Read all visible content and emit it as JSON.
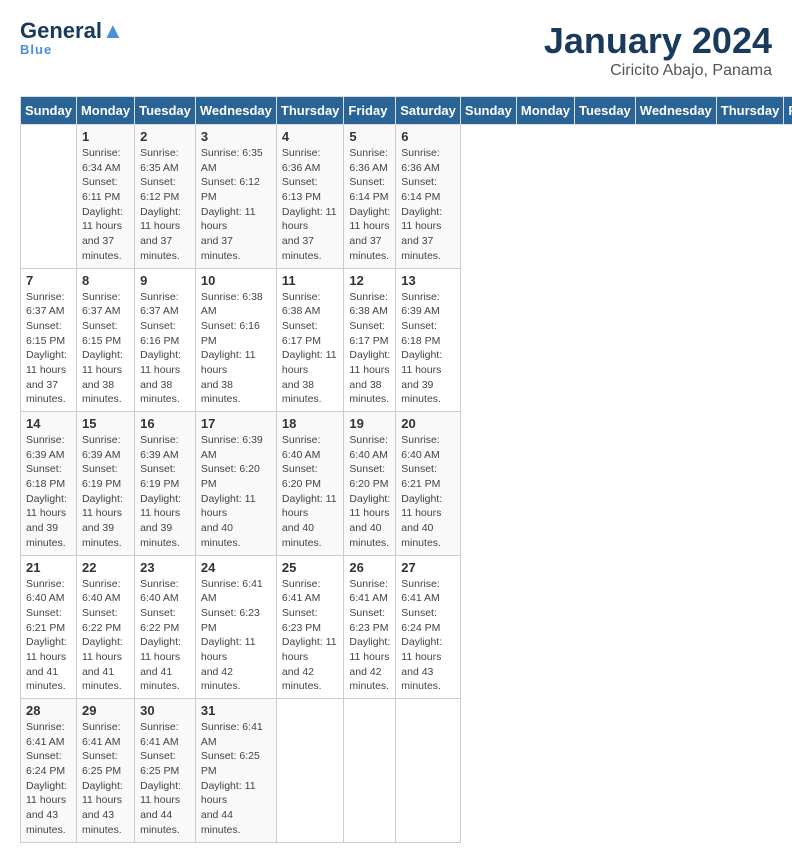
{
  "logo": {
    "line1": "General",
    "line2": "Blue",
    "tagline": "Blue"
  },
  "title": "January 2024",
  "location": "Ciricito Abajo, Panama",
  "days_of_week": [
    "Sunday",
    "Monday",
    "Tuesday",
    "Wednesday",
    "Thursday",
    "Friday",
    "Saturday"
  ],
  "weeks": [
    [
      {
        "day": "",
        "info": ""
      },
      {
        "day": "1",
        "info": "Sunrise: 6:34 AM\nSunset: 6:11 PM\nDaylight: 11 hours\nand 37 minutes."
      },
      {
        "day": "2",
        "info": "Sunrise: 6:35 AM\nSunset: 6:12 PM\nDaylight: 11 hours\nand 37 minutes."
      },
      {
        "day": "3",
        "info": "Sunrise: 6:35 AM\nSunset: 6:12 PM\nDaylight: 11 hours\nand 37 minutes."
      },
      {
        "day": "4",
        "info": "Sunrise: 6:36 AM\nSunset: 6:13 PM\nDaylight: 11 hours\nand 37 minutes."
      },
      {
        "day": "5",
        "info": "Sunrise: 6:36 AM\nSunset: 6:14 PM\nDaylight: 11 hours\nand 37 minutes."
      },
      {
        "day": "6",
        "info": "Sunrise: 6:36 AM\nSunset: 6:14 PM\nDaylight: 11 hours\nand 37 minutes."
      }
    ],
    [
      {
        "day": "7",
        "info": "Sunrise: 6:37 AM\nSunset: 6:15 PM\nDaylight: 11 hours\nand 37 minutes."
      },
      {
        "day": "8",
        "info": "Sunrise: 6:37 AM\nSunset: 6:15 PM\nDaylight: 11 hours\nand 38 minutes."
      },
      {
        "day": "9",
        "info": "Sunrise: 6:37 AM\nSunset: 6:16 PM\nDaylight: 11 hours\nand 38 minutes."
      },
      {
        "day": "10",
        "info": "Sunrise: 6:38 AM\nSunset: 6:16 PM\nDaylight: 11 hours\nand 38 minutes."
      },
      {
        "day": "11",
        "info": "Sunrise: 6:38 AM\nSunset: 6:17 PM\nDaylight: 11 hours\nand 38 minutes."
      },
      {
        "day": "12",
        "info": "Sunrise: 6:38 AM\nSunset: 6:17 PM\nDaylight: 11 hours\nand 38 minutes."
      },
      {
        "day": "13",
        "info": "Sunrise: 6:39 AM\nSunset: 6:18 PM\nDaylight: 11 hours\nand 39 minutes."
      }
    ],
    [
      {
        "day": "14",
        "info": "Sunrise: 6:39 AM\nSunset: 6:18 PM\nDaylight: 11 hours\nand 39 minutes."
      },
      {
        "day": "15",
        "info": "Sunrise: 6:39 AM\nSunset: 6:19 PM\nDaylight: 11 hours\nand 39 minutes."
      },
      {
        "day": "16",
        "info": "Sunrise: 6:39 AM\nSunset: 6:19 PM\nDaylight: 11 hours\nand 39 minutes."
      },
      {
        "day": "17",
        "info": "Sunrise: 6:39 AM\nSunset: 6:20 PM\nDaylight: 11 hours\nand 40 minutes."
      },
      {
        "day": "18",
        "info": "Sunrise: 6:40 AM\nSunset: 6:20 PM\nDaylight: 11 hours\nand 40 minutes."
      },
      {
        "day": "19",
        "info": "Sunrise: 6:40 AM\nSunset: 6:20 PM\nDaylight: 11 hours\nand 40 minutes."
      },
      {
        "day": "20",
        "info": "Sunrise: 6:40 AM\nSunset: 6:21 PM\nDaylight: 11 hours\nand 40 minutes."
      }
    ],
    [
      {
        "day": "21",
        "info": "Sunrise: 6:40 AM\nSunset: 6:21 PM\nDaylight: 11 hours\nand 41 minutes."
      },
      {
        "day": "22",
        "info": "Sunrise: 6:40 AM\nSunset: 6:22 PM\nDaylight: 11 hours\nand 41 minutes."
      },
      {
        "day": "23",
        "info": "Sunrise: 6:40 AM\nSunset: 6:22 PM\nDaylight: 11 hours\nand 41 minutes."
      },
      {
        "day": "24",
        "info": "Sunrise: 6:41 AM\nSunset: 6:23 PM\nDaylight: 11 hours\nand 42 minutes."
      },
      {
        "day": "25",
        "info": "Sunrise: 6:41 AM\nSunset: 6:23 PM\nDaylight: 11 hours\nand 42 minutes."
      },
      {
        "day": "26",
        "info": "Sunrise: 6:41 AM\nSunset: 6:23 PM\nDaylight: 11 hours\nand 42 minutes."
      },
      {
        "day": "27",
        "info": "Sunrise: 6:41 AM\nSunset: 6:24 PM\nDaylight: 11 hours\nand 43 minutes."
      }
    ],
    [
      {
        "day": "28",
        "info": "Sunrise: 6:41 AM\nSunset: 6:24 PM\nDaylight: 11 hours\nand 43 minutes."
      },
      {
        "day": "29",
        "info": "Sunrise: 6:41 AM\nSunset: 6:25 PM\nDaylight: 11 hours\nand 43 minutes."
      },
      {
        "day": "30",
        "info": "Sunrise: 6:41 AM\nSunset: 6:25 PM\nDaylight: 11 hours\nand 44 minutes."
      },
      {
        "day": "31",
        "info": "Sunrise: 6:41 AM\nSunset: 6:25 PM\nDaylight: 11 hours\nand 44 minutes."
      },
      {
        "day": "",
        "info": ""
      },
      {
        "day": "",
        "info": ""
      },
      {
        "day": "",
        "info": ""
      }
    ]
  ]
}
